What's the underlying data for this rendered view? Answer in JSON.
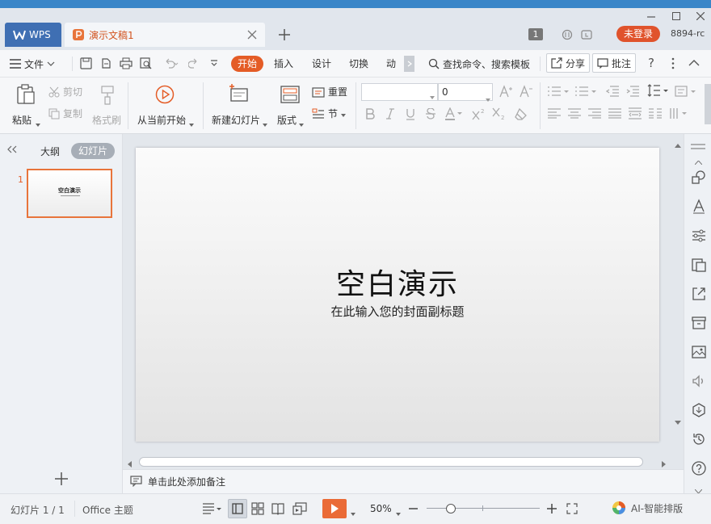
{
  "titlebar": {
    "app_tab": "WPS",
    "doc_tab": "演示文稿1",
    "window_badge": "1",
    "login": "未登录",
    "user_id": "8894-rc"
  },
  "menubar": {
    "file": "文件",
    "tabs": [
      "开始",
      "插入",
      "设计",
      "切换",
      "动画"
    ],
    "search": "查找命令、搜索模板",
    "share": "分享",
    "comment": "批注",
    "help": "?"
  },
  "ribbon": {
    "paste": "粘贴",
    "cut": "剪切",
    "copy": "复制",
    "format_painter": "格式刷",
    "play_from_current": "从当前开始",
    "new_slide": "新建幻灯片",
    "layout": "版式",
    "reset": "重置",
    "section": "节",
    "font_size": "0"
  },
  "leftpane": {
    "outline_tab": "大纲",
    "slides_tab": "幻灯片",
    "thumb_number": "1",
    "thumb_title": "空白演示"
  },
  "slide": {
    "title": "空白演示",
    "subtitle": "在此输入您的封面副标题"
  },
  "notes": {
    "placeholder": "单击此处添加备注"
  },
  "statusbar": {
    "slide_count": "幻灯片 1 / 1",
    "theme": "Office 主题",
    "zoom": "50%",
    "ai_layout": "AI-智能排版"
  },
  "colors": {
    "accent": "#e45c26",
    "wps_blue": "#3f6fb3",
    "thumb_border": "#e8743b"
  }
}
